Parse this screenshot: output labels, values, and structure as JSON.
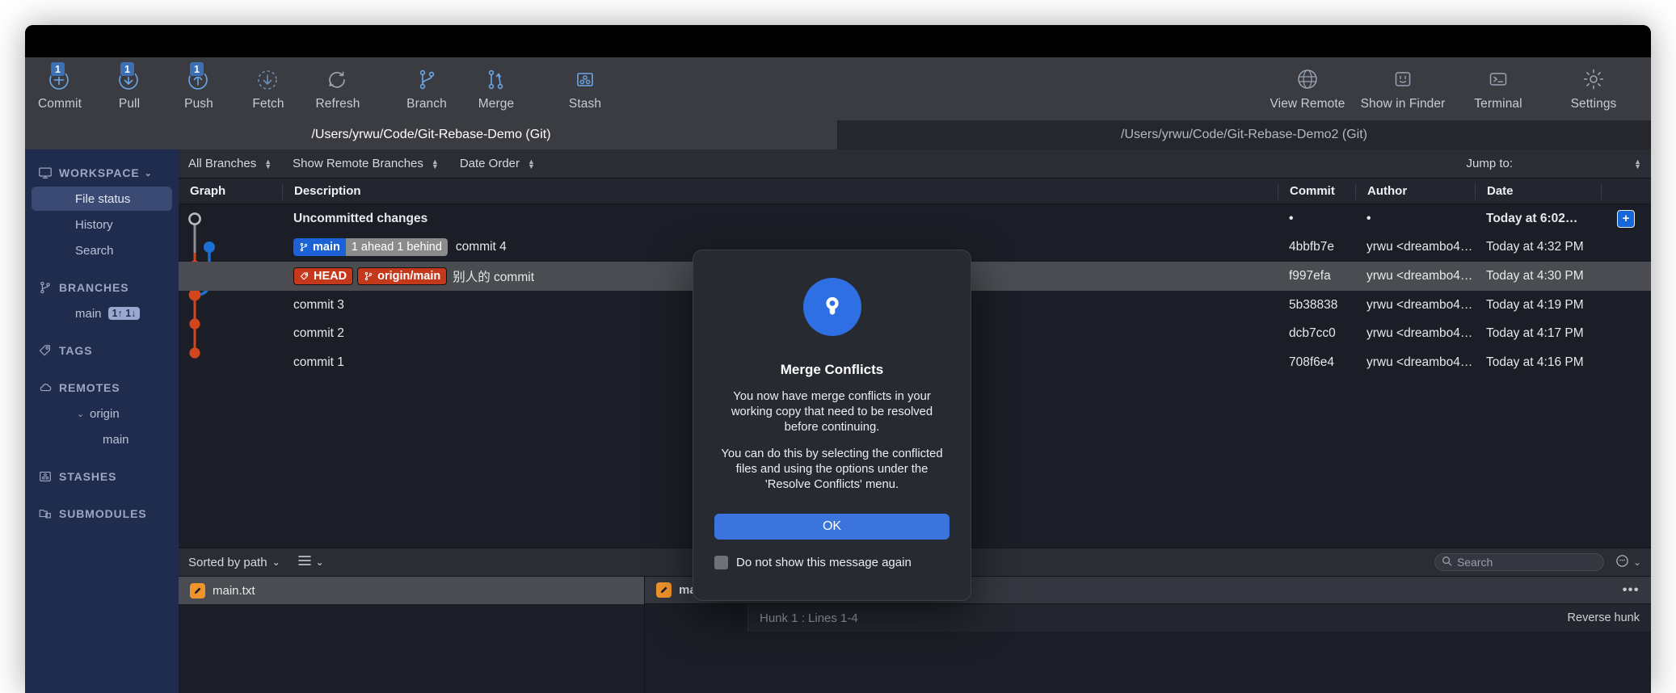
{
  "toolbar": {
    "left_items": [
      {
        "label": "Commit",
        "icon": "commit-plus-icon",
        "badge": "1"
      },
      {
        "label": "Pull",
        "icon": "pull-down-arrow-icon",
        "badge": "1"
      },
      {
        "label": "Push",
        "icon": "push-up-arrow-icon",
        "badge": "1"
      },
      {
        "label": "Fetch",
        "icon": "fetch-dashed-circle-icon",
        "badge": ""
      },
      {
        "label": "Refresh",
        "icon": "refresh-icon",
        "badge": ""
      },
      {
        "label": "Branch",
        "icon": "branch-icon",
        "badge": ""
      },
      {
        "label": "Merge",
        "icon": "merge-icon",
        "badge": ""
      },
      {
        "label": "Stash",
        "icon": "stash-icon",
        "badge": ""
      }
    ],
    "right_items": [
      {
        "label": "View Remote",
        "icon": "globe-icon"
      },
      {
        "label": "Show in Finder",
        "icon": "finder-icon"
      },
      {
        "label": "Terminal",
        "icon": "terminal-icon"
      },
      {
        "label": "Settings",
        "icon": "gear-icon"
      }
    ]
  },
  "tabs": [
    {
      "label": "/Users/yrwu/Code/Git-Rebase-Demo (Git)",
      "active": true
    },
    {
      "label": "/Users/yrwu/Code/Git-Rebase-Demo2 (Git)",
      "active": false
    }
  ],
  "sidebar": {
    "sections": [
      {
        "title": "WORKSPACE",
        "icon": "monitor-icon",
        "chevron": "⌄"
      },
      {
        "title": "BRANCHES",
        "icon": "branch-icon",
        "chevron": ""
      },
      {
        "title": "TAGS",
        "icon": "tag-icon",
        "chevron": ""
      },
      {
        "title": "REMOTES",
        "icon": "cloud-icon",
        "chevron": ""
      },
      {
        "title": "STASHES",
        "icon": "stash-icon",
        "chevron": ""
      },
      {
        "title": "SUBMODULES",
        "icon": "submodule-icon",
        "chevron": ""
      }
    ],
    "workspace_items": [
      {
        "label": "File status",
        "selected": true
      },
      {
        "label": "History",
        "selected": false
      },
      {
        "label": "Search",
        "selected": false
      }
    ],
    "branch_item": {
      "label": "main",
      "badge": "1↑ 1↓"
    },
    "remote_items": [
      {
        "label": "origin",
        "caret": "⌄"
      },
      {
        "label": "main",
        "caret": ""
      }
    ]
  },
  "filterbar": {
    "branch_filter": "All Branches",
    "remote_filter": "Show Remote Branches",
    "order_filter": "Date Order",
    "jump_to": "Jump to:"
  },
  "columns": {
    "graph": "Graph",
    "description": "Description",
    "commit": "Commit",
    "author": "Author",
    "date": "Date"
  },
  "commits": [
    {
      "description": "Uncommitted changes",
      "bold": true,
      "refs": [],
      "commit": "•",
      "author": "•",
      "date": "Today at 6:02…",
      "selected": false,
      "has_plus": true
    },
    {
      "description": "commit 4",
      "bold": false,
      "refs": [
        {
          "text": "main",
          "style": "blue",
          "icon": "branch-icon"
        },
        {
          "text": "1 ahead 1 behind",
          "style": "gray",
          "icon": ""
        }
      ],
      "commit": "4bbfb7e",
      "author": "yrwu <dreambo4…",
      "date": "Today at 4:32 PM",
      "selected": false,
      "has_plus": false
    },
    {
      "description": "别人的 commit",
      "bold": false,
      "refs": [
        {
          "text": "HEAD",
          "style": "red",
          "icon": "tag-icon"
        },
        {
          "text": "origin/main",
          "style": "red",
          "icon": "branch-icon"
        }
      ],
      "commit": "f997efa",
      "author": "yrwu <dreambo4…",
      "date": "Today at 4:30 PM",
      "selected": true,
      "has_plus": false
    },
    {
      "description": "commit 3",
      "bold": false,
      "refs": [],
      "commit": "5b38838",
      "author": "yrwu <dreambo4…",
      "date": "Today at 4:19 PM",
      "selected": false,
      "has_plus": false
    },
    {
      "description": "commit 2",
      "bold": false,
      "refs": [],
      "commit": "dcb7cc0",
      "author": "yrwu <dreambo4…",
      "date": "Today at 4:17 PM",
      "selected": false,
      "has_plus": false
    },
    {
      "description": "commit 1",
      "bold": false,
      "refs": [],
      "commit": "708f6e4",
      "author": "yrwu <dreambo4…",
      "date": "Today at 4:16 PM",
      "selected": false,
      "has_plus": false
    }
  ],
  "bottom": {
    "sort_label": "Sorted by path",
    "sort_chevron": "⌄",
    "list_icon": "list-view-icon",
    "list_chevron": "⌄",
    "search_placeholder": "Search",
    "emoji_icon": "emoji-icon",
    "emoji_chevron": "⌄",
    "file_name": "main.txt",
    "diff_file_name": "main.txt",
    "diff_more": "•••",
    "hunk_label": "Hunk 1 : Lines 1-4",
    "reverse_hunk": "Reverse hunk"
  },
  "modal": {
    "logo_icon": "sourcetree-logo-icon",
    "title": "Merge Conflicts",
    "paragraph1": "You now have merge conflicts in your working copy that need to be resolved before continuing.",
    "paragraph2": "You can do this by selecting the conflicted files and using the options under the 'Resolve Conflicts' menu.",
    "ok_label": "OK",
    "checkbox_label": "Do not show this message again"
  },
  "colors": {
    "accent_blue": "#3b74dd",
    "branch_blue": "#1a62d6",
    "ref_red": "#c4381b",
    "graph_orange": "#d2461d",
    "graph_blue": "#1b6fd3",
    "sidebar_navy": "#1f2c4d",
    "file_orange": "#f0932b"
  }
}
